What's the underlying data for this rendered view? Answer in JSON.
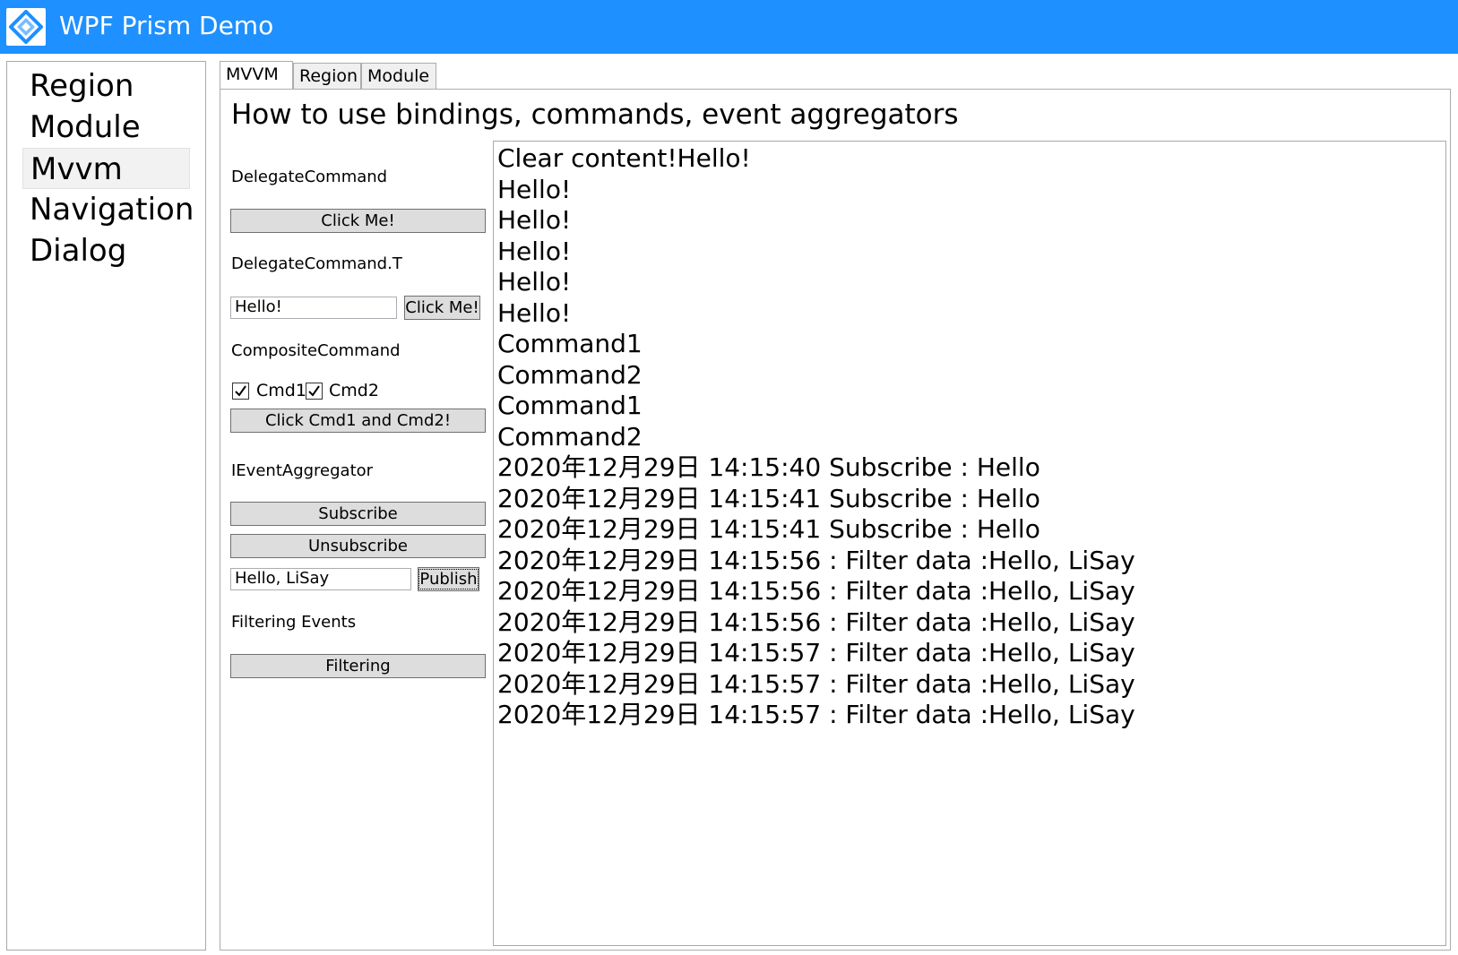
{
  "window": {
    "title": "WPF Prism Demo",
    "icon": "prism-logo-icon",
    "accent_color": "#1e90ff"
  },
  "menu": {
    "items": [
      {
        "label": "Region",
        "selected": false
      },
      {
        "label": "Module",
        "selected": false
      },
      {
        "label": "Mvvm",
        "selected": true
      },
      {
        "label": "Navigation",
        "selected": false
      },
      {
        "label": "Dialog",
        "selected": false
      }
    ]
  },
  "tabs": [
    {
      "label": "MVVM",
      "active": true
    },
    {
      "label": "Region",
      "active": false
    },
    {
      "label": "Module",
      "active": false
    }
  ],
  "mvvm": {
    "heading": "How to use bindings, commands, event aggregators",
    "delegate_command": {
      "label": "DelegateCommand",
      "button": "Click Me!"
    },
    "delegate_command_t": {
      "label": "DelegateCommand.T",
      "input_value": "Hello!",
      "button": "Click Me!"
    },
    "composite_command": {
      "label": "CompositeCommand",
      "cmd1_label": "Cmd1",
      "cmd1_checked": true,
      "cmd2_label": "Cmd2",
      "cmd2_checked": true,
      "button": "Click Cmd1 and Cmd2!"
    },
    "event_aggregator": {
      "label": "IEventAggregator",
      "subscribe_button": "Subscribe",
      "unsubscribe_button": "Unsubscribe",
      "publish_input_value": "Hello, LiSay",
      "publish_button": "Publish"
    },
    "filtering": {
      "label": "Filtering Events",
      "button": "Filtering"
    }
  },
  "output": {
    "lines": [
      "Clear content!Hello!",
      "Hello!",
      "Hello!",
      "Hello!",
      "Hello!",
      "Hello!",
      "Command1",
      "Command2",
      "Command1",
      "Command2",
      "2020年12月29日 14:15:40 Subscribe : Hello",
      "2020年12月29日 14:15:41 Subscribe : Hello",
      "2020年12月29日 14:15:41 Subscribe : Hello",
      "2020年12月29日 14:15:56 : Filter data :Hello, LiSay",
      "2020年12月29日 14:15:56 : Filter data :Hello, LiSay",
      "2020年12月29日 14:15:56 : Filter data :Hello, LiSay",
      "2020年12月29日 14:15:57 : Filter data :Hello, LiSay",
      "2020年12月29日 14:15:57 : Filter data :Hello, LiSay",
      "2020年12月29日 14:15:57 : Filter data :Hello, LiSay"
    ]
  }
}
